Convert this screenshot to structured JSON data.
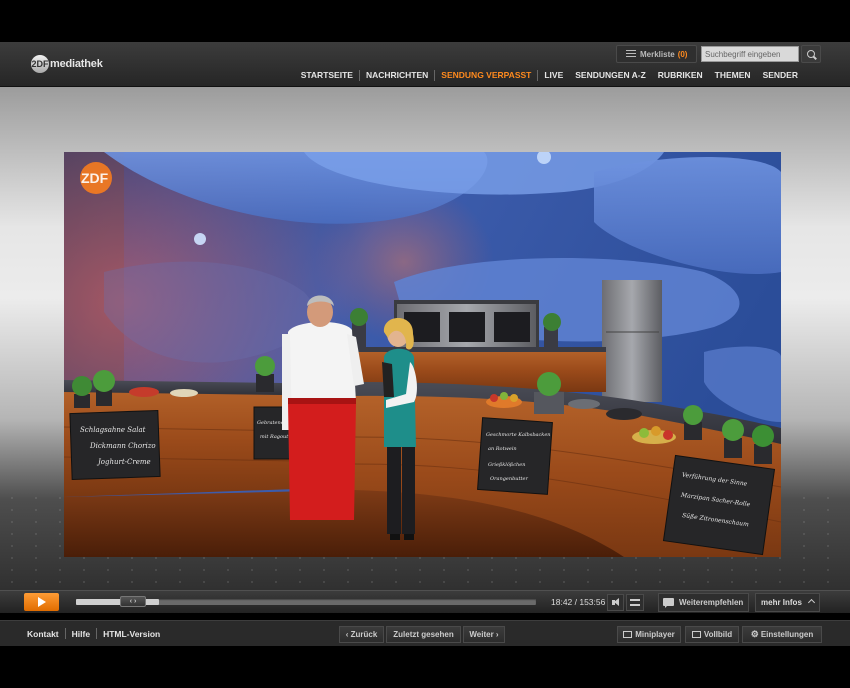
{
  "header": {
    "logo_circle": "2DF",
    "logo_text": "mediathek",
    "merkliste_label": "Merkliste",
    "merkliste_count": "(0)",
    "search_placeholder": "Suchbegriff eingeben",
    "nav": [
      {
        "label": "STARTSEITE"
      },
      {
        "label": "NACHRICHTEN"
      },
      {
        "label": "SENDUNG VERPASST",
        "active": true
      },
      {
        "label": "LIVE"
      },
      {
        "label": "SENDUNGEN A-Z"
      },
      {
        "label": "RUBRIKEN"
      },
      {
        "label": "THEMEN"
      },
      {
        "label": "SENDER"
      }
    ]
  },
  "video": {
    "watermark": "ZDF",
    "chalkboards": [
      [
        "Schlagsahne Salat",
        "Dickmann Chorizo",
        "Joghurt-Creme"
      ],
      [
        "Gebratene Leber",
        "mit Ragout"
      ],
      [
        "Geschmorte Kalbsbacken",
        "an Rotwein",
        "Grießklößchen",
        "Orangenbutter"
      ],
      [
        "Verführung der Sinne",
        "Marzipan Sacher-Rolle",
        "Süße Zitronenschaum"
      ]
    ]
  },
  "player": {
    "handle_label": "‹ ›",
    "time": "18:42 / 153:56",
    "progress": 0.18,
    "recommend_label": "Weiterempfehlen",
    "more_info_label": "mehr Infos"
  },
  "footer": {
    "links": [
      "Kontakt",
      "Hilfe",
      "HTML-Version"
    ],
    "back_label": "‹ Zurück",
    "recent_label": "Zuletzt gesehen",
    "next_label": "Weiter ›",
    "miniplayer_label": "Miniplayer",
    "vollbild_label": "Vollbild",
    "settings_label": "Einstellungen"
  },
  "colors": {
    "accent": "#ff8a1e",
    "header_bg": "#2b2b2b",
    "chalkboard": "#2a2a2a",
    "apron": "#d31d1d",
    "wood": "#a4541f"
  }
}
